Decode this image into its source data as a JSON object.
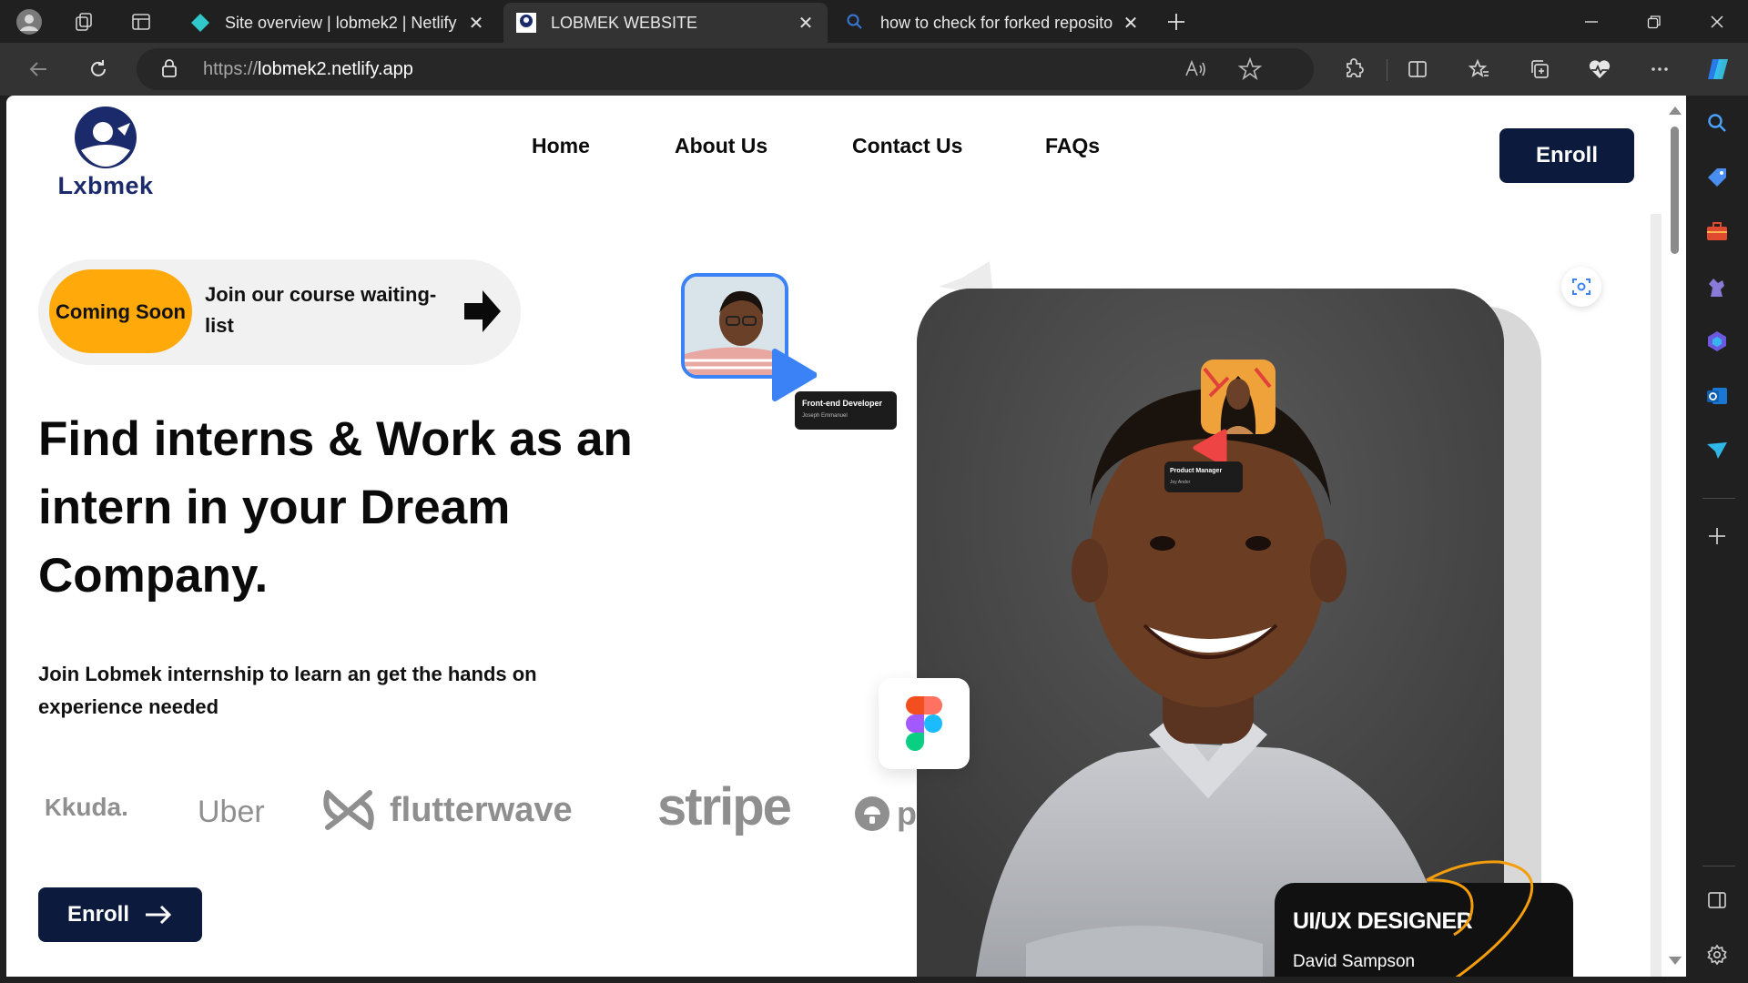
{
  "browser": {
    "tabs": [
      {
        "title": "Site overview | lobmek2 | Netlify",
        "icon": "netlify-icon",
        "active": false
      },
      {
        "title": "LOBMEK WEBSITE",
        "icon": "lobmek-favicon-icon",
        "active": true
      },
      {
        "title": "how to check for forked repositories",
        "icon": "search-icon",
        "active": false
      }
    ],
    "url_protocol": "https://",
    "url_host": "lobmek2.netlify.app",
    "accent": "#0c1a3d"
  },
  "site": {
    "logo_text": "Lxbmek",
    "nav": [
      {
        "label": "Home"
      },
      {
        "label": "About Us"
      },
      {
        "label": "Contact Us"
      },
      {
        "label": "FAQs"
      }
    ],
    "enroll_top": "Enroll",
    "pill": {
      "badge": "Coming Soon",
      "text": "Join our course waiting-list"
    },
    "hero_title": "Find interns & Work as an intern in your Dream Company.",
    "hero_subtitle": "Join Lobmek internship to learn an get the hands on experience needed",
    "partners": [
      "kuda.",
      "Uber",
      "flutterwave",
      "stripe",
      "p"
    ],
    "enroll_bottom": "Enroll",
    "cards": {
      "frontend_role": "Front-end Developer",
      "frontend_name": "Joseph Emmanuel",
      "pm_role": "Product Manager",
      "pm_name": "Joy Andor",
      "uiux_role": "UI/UX DESIGNER",
      "uiux_name": "David Sampson"
    }
  }
}
